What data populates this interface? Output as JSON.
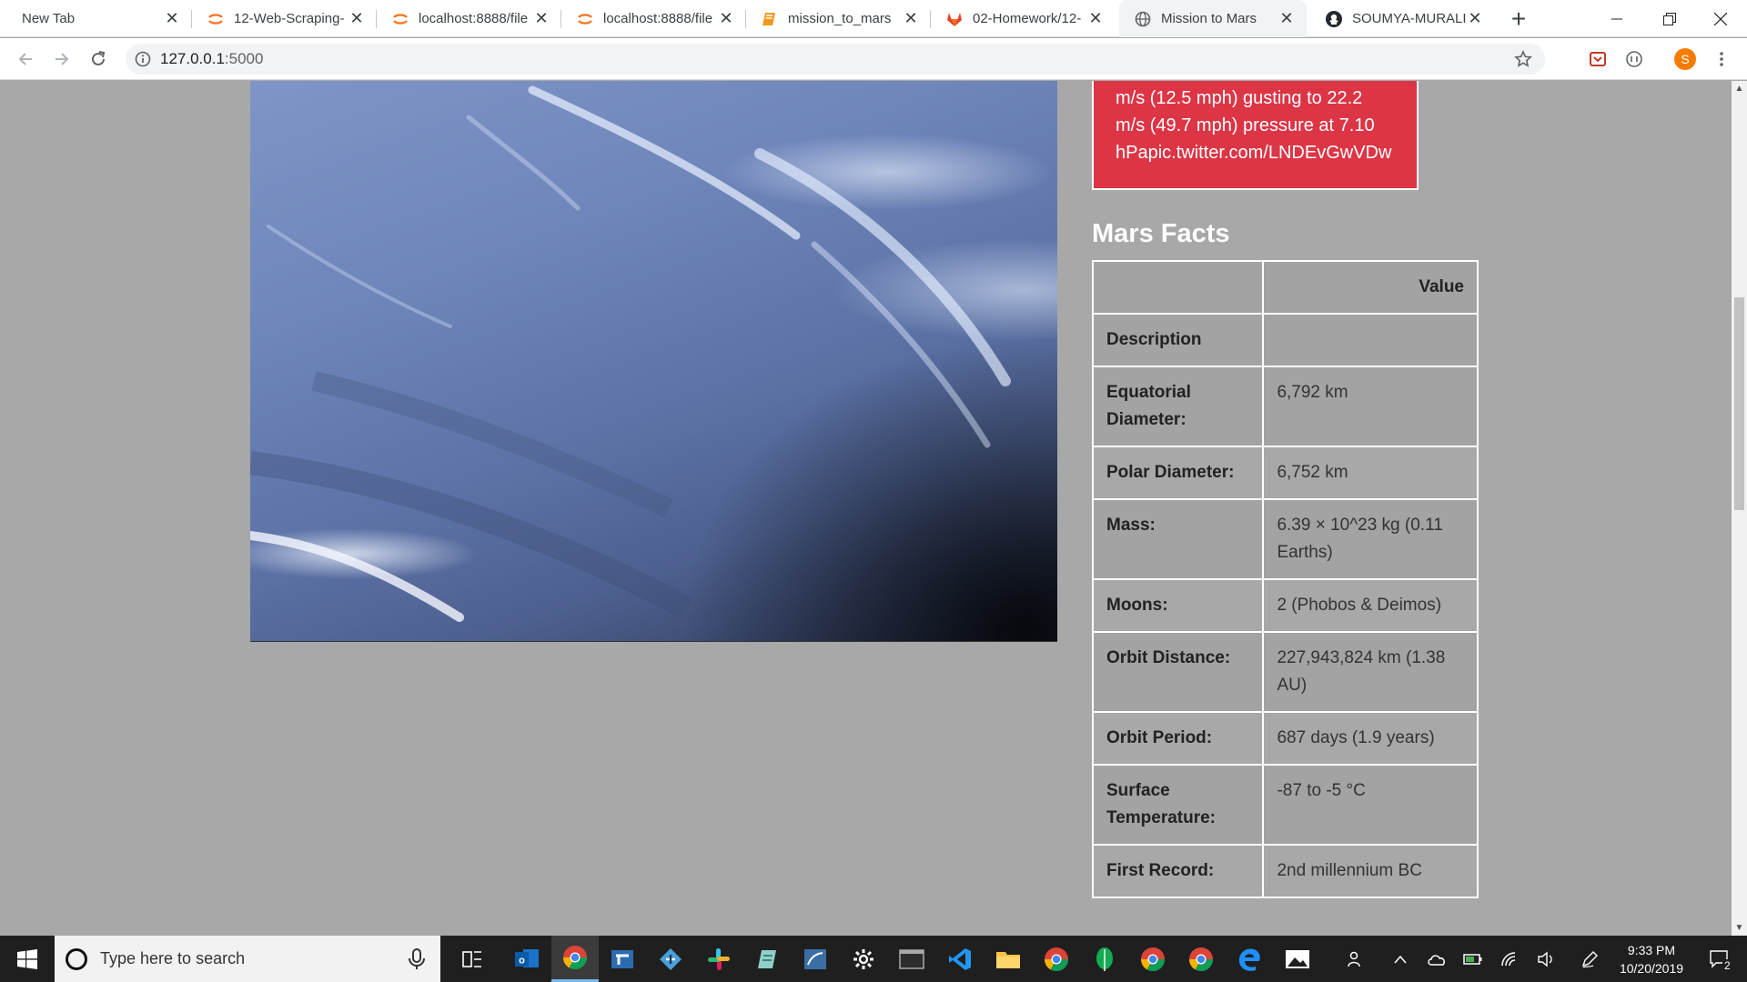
{
  "browser": {
    "tabs": [
      {
        "title": "New Tab",
        "favicon": "none",
        "active": false
      },
      {
        "title": "12-Web-Scraping-",
        "favicon": "jupyter-icon",
        "active": false
      },
      {
        "title": "localhost:8888/file",
        "favicon": "jupyter-icon",
        "active": false
      },
      {
        "title": "localhost:8888/file",
        "favicon": "jupyter-icon",
        "active": false
      },
      {
        "title": "mission_to_mars",
        "favicon": "notebook-icon",
        "active": false
      },
      {
        "title": "02-Homework/12-",
        "favicon": "gitlab-icon",
        "active": false
      },
      {
        "title": "Mission to Mars",
        "favicon": "globe-icon",
        "active": true
      },
      {
        "title": "SOUMYA-MURALI",
        "favicon": "github-icon",
        "active": false
      }
    ],
    "url_host": "127.0.0.1",
    "url_port": ":5000",
    "profile_initial": "S"
  },
  "page": {
    "tweet_lines": [
      "m/s (12.5 mph) gusting to 22.2",
      "m/s (49.7 mph) pressure at 7.10",
      "hPapic.twitter.com/LNDEvGwVDw"
    ],
    "facts_heading": "Mars Facts",
    "facts_table": {
      "header": [
        "",
        "Value"
      ],
      "index_label": "Description",
      "rows": [
        {
          "label": "Equatorial Diameter:",
          "value": "6,792 km"
        },
        {
          "label": "Polar Diameter:",
          "value": "6,752 km"
        },
        {
          "label": "Mass:",
          "value": "6.39 × 10^23 kg (0.11 Earths)"
        },
        {
          "label": "Moons:",
          "value": "2 (Phobos & Deimos)"
        },
        {
          "label": "Orbit Distance:",
          "value": "227,943,824 km (1.38 AU)"
        },
        {
          "label": "Orbit Period:",
          "value": "687 days (1.9 years)"
        },
        {
          "label": "Surface Temperature:",
          "value": "-87 to -5 °C"
        },
        {
          "label": "First Record:",
          "value": "2nd millennium BC"
        }
      ]
    }
  },
  "taskbar": {
    "search_placeholder": "Type here to search",
    "time": "9:33 PM",
    "date": "10/20/2019",
    "notification_count": "2"
  }
}
